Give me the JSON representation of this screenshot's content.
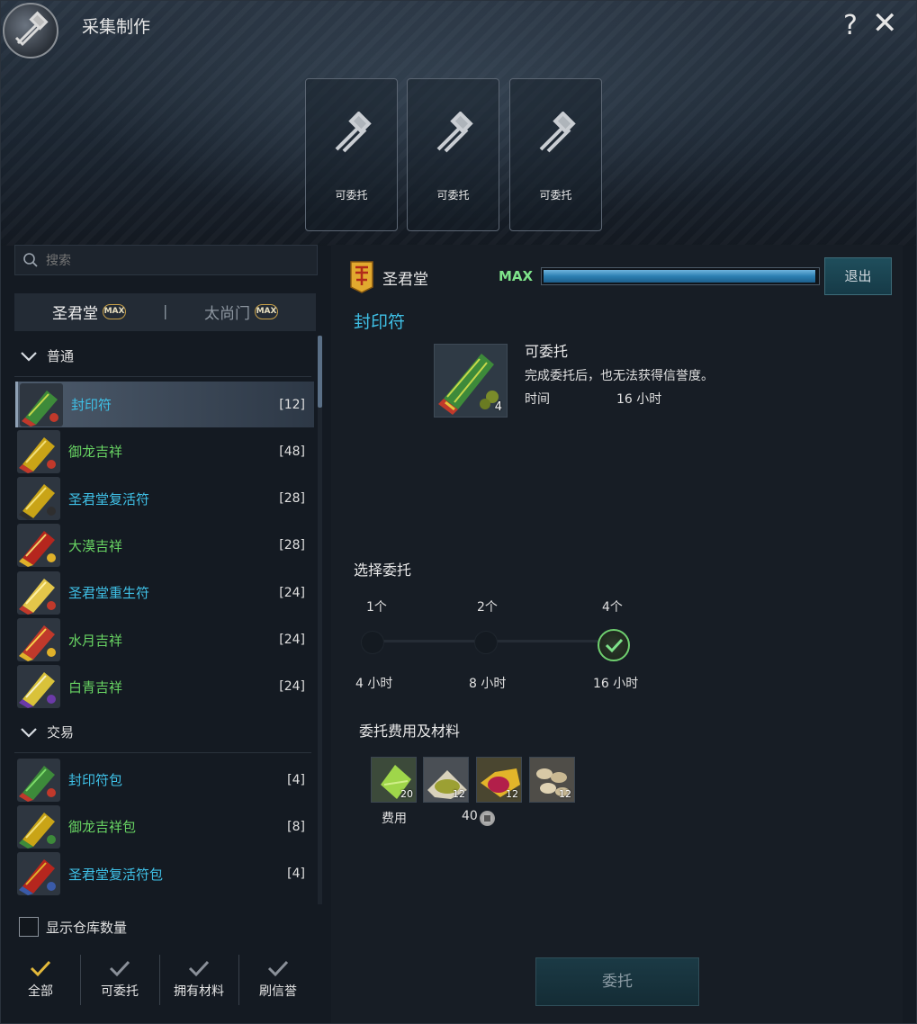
{
  "window": {
    "title": "采集制作",
    "help": "?",
    "close": "✕"
  },
  "slots": [
    {
      "label": "可委托"
    },
    {
      "label": "可委托"
    },
    {
      "label": "可委托"
    }
  ],
  "search": {
    "placeholder": "搜索"
  },
  "factions": [
    {
      "name": "圣君堂",
      "badge": "MAX",
      "active": true
    },
    {
      "name": "太尚门",
      "badge": "MAX",
      "active": false
    }
  ],
  "factions_sep": "|",
  "categories": {
    "normal": "普通",
    "trade": "交易"
  },
  "items_normal": [
    {
      "name": "封印符",
      "count": "[12]",
      "color": "#3fc0e6",
      "selected": true
    },
    {
      "name": "御龙吉祥",
      "count": "[48]",
      "color": "#68d463"
    },
    {
      "name": "圣君堂复活符",
      "count": "[28]",
      "color": "#3fc0e6"
    },
    {
      "name": "大漠吉祥",
      "count": "[28]",
      "color": "#68d463"
    },
    {
      "name": "圣君堂重生符",
      "count": "[24]",
      "color": "#3fc0e6"
    },
    {
      "name": "水月吉祥",
      "count": "[24]",
      "color": "#68d463"
    },
    {
      "name": "白青吉祥",
      "count": "[24]",
      "color": "#68d463"
    }
  ],
  "items_trade": [
    {
      "name": "封印符包",
      "count": "[4]",
      "color": "#3fc0e6"
    },
    {
      "name": "御龙吉祥包",
      "count": "[8]",
      "color": "#68d463"
    },
    {
      "name": "圣君堂复活符包",
      "count": "[4]",
      "color": "#3fc0e6"
    }
  ],
  "storage": {
    "label": "显示仓库数量",
    "checked": false
  },
  "filters": [
    {
      "label": "全部",
      "active": true
    },
    {
      "label": "可委托",
      "active": false
    },
    {
      "label": "拥有材料",
      "active": false
    },
    {
      "label": "刷信誉",
      "active": false
    }
  ],
  "detail": {
    "faction": "圣君堂",
    "max": "MAX",
    "progress": 1.0,
    "exit": "退出",
    "recipe_name": "封印符",
    "qty": "4",
    "status": "可委托",
    "desc": "完成委托后，也无法获得信誉度。",
    "time_label": "时间",
    "time_value": "16 小时"
  },
  "commission": {
    "title": "选择委托",
    "options": [
      {
        "count": "1个",
        "hours": "4 小时"
      },
      {
        "count": "2个",
        "hours": "8 小时"
      },
      {
        "count": "4个",
        "hours": "16 小时",
        "selected": true
      }
    ]
  },
  "cost": {
    "title": "委托费用及材料",
    "materials": [
      {
        "name": "green-leaf-material",
        "qty": "20"
      },
      {
        "name": "seed-pile-material",
        "qty": "12"
      },
      {
        "name": "red-gem-material",
        "qty": "12"
      },
      {
        "name": "bean-pile-material",
        "qty": "12"
      }
    ],
    "fee_label": "费用",
    "fee_value": "40"
  },
  "submit": "委托",
  "colors": {
    "accent": "#3fc0e6",
    "green": "#68d463",
    "max": "#7ee38a"
  }
}
